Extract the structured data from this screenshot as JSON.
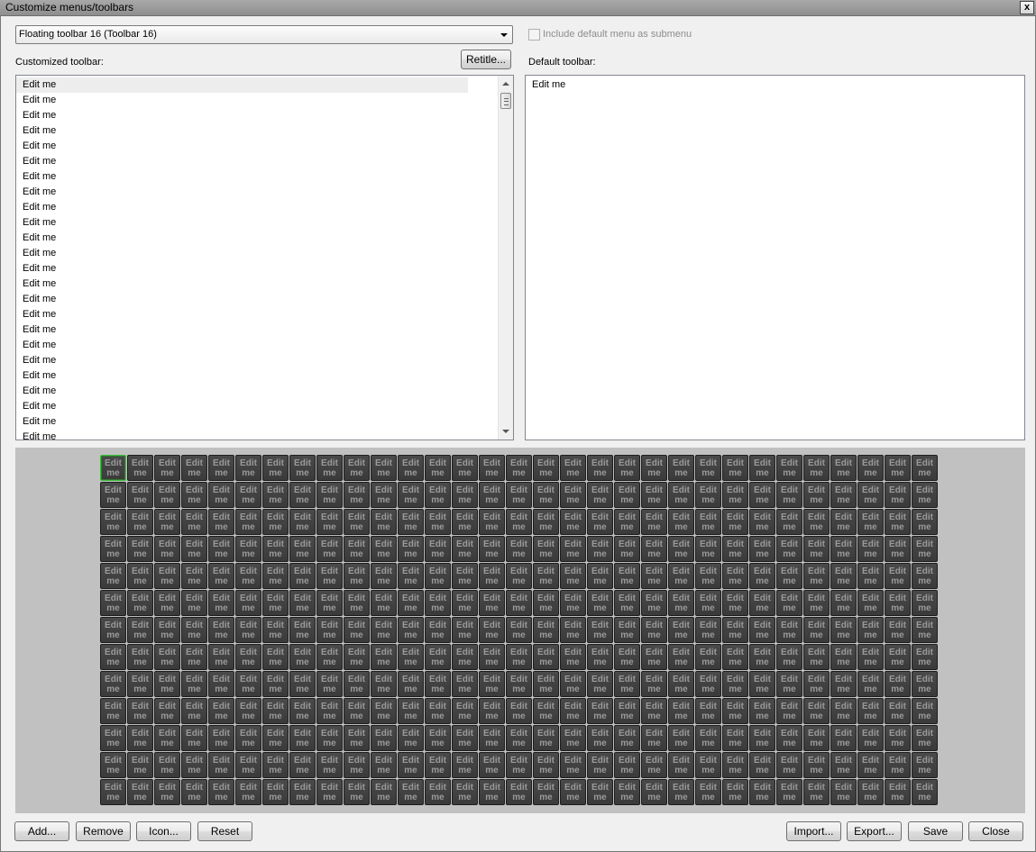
{
  "window": {
    "title": "Customize menus/toolbars",
    "close_glyph": "x"
  },
  "toolbar_select": {
    "value": "Floating toolbar 16 (Toolbar 16)"
  },
  "include_default": {
    "label": "Include default menu as submenu",
    "checked": false
  },
  "customized": {
    "label": "Customized toolbar:",
    "retitle_label": "Retitle...",
    "item_text": "Edit me",
    "item_count": 24
  },
  "default_toolbar": {
    "label": "Default toolbar:",
    "items": [
      "Edit me"
    ]
  },
  "icon_grid": {
    "tile_text": "Edit\nme",
    "columns": 31,
    "rows": 13,
    "active_index": 0,
    "tile_color": "#404040",
    "active_color": "#3fbf3f"
  },
  "buttons": {
    "add": "Add...",
    "remove": "Remove",
    "icon": "Icon...",
    "reset": "Reset",
    "import": "Import...",
    "export": "Export...",
    "save": "Save",
    "close": "Close"
  }
}
